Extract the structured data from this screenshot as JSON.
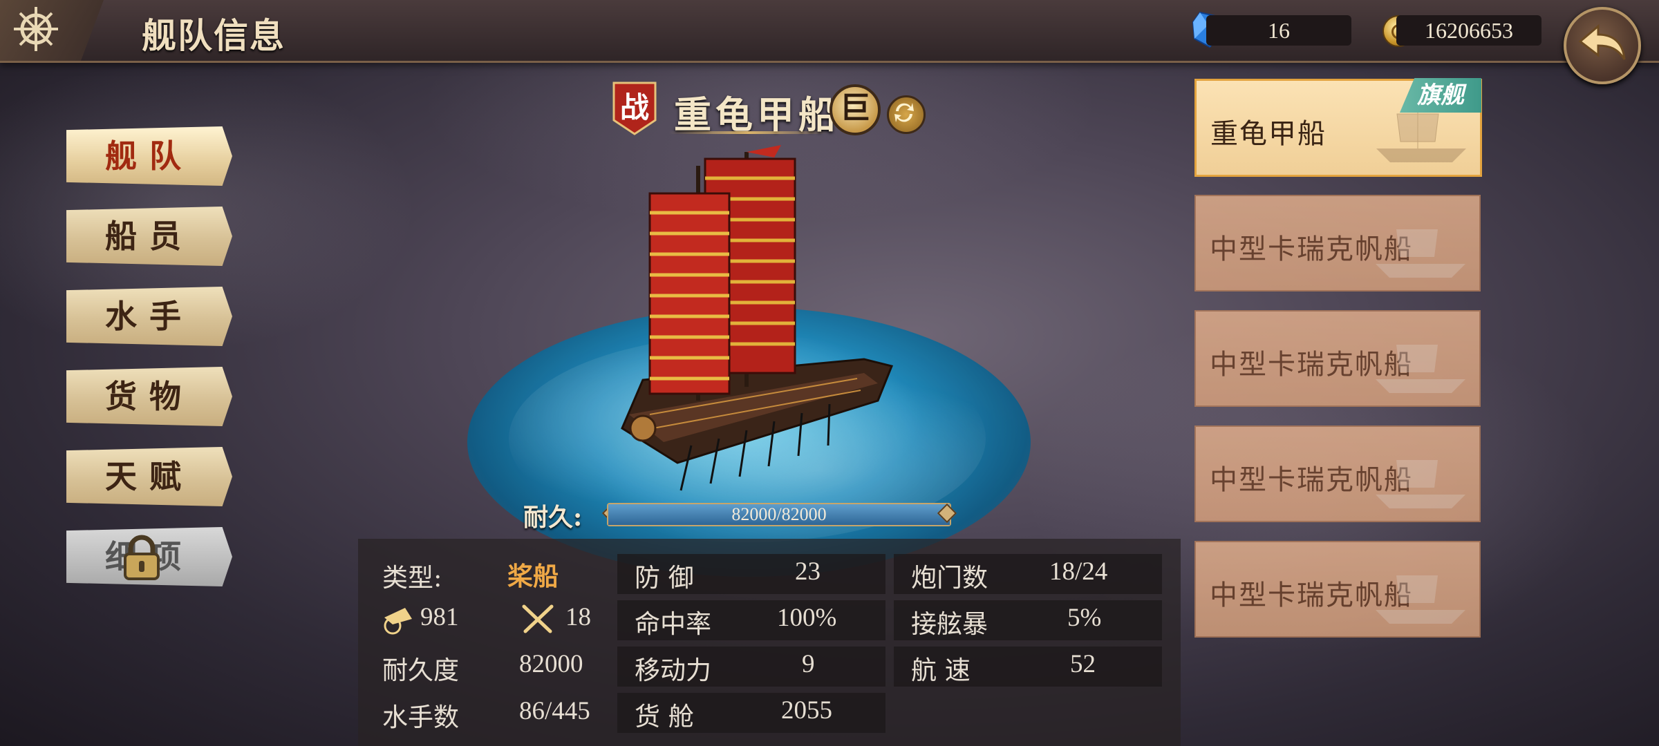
{
  "header": {
    "title": "舰队信息"
  },
  "resources": {
    "gems": "16",
    "coins": "16206653"
  },
  "menu": [
    {
      "label": "舰队",
      "active": true
    },
    {
      "label": "船员",
      "active": false
    },
    {
      "label": "水手",
      "active": false
    },
    {
      "label": "货物",
      "active": false
    },
    {
      "label": "天赋",
      "active": false
    },
    {
      "label": "细项",
      "active": false,
      "locked": true
    }
  ],
  "ship": {
    "badge": "战",
    "name": "重龟甲船",
    "size": "巨",
    "durability_label": "耐久:",
    "durability_text": "82000/82000",
    "durability_ratio": 1.0
  },
  "stats": {
    "type_label": "类型:",
    "type_value": "桨船",
    "cannon_value": "981",
    "melee_value": "18",
    "durability_label": "耐久度",
    "durability_value": "82000",
    "sailors_label": "水手数",
    "sailors_value": "86/445",
    "defense_label": "防 御",
    "defense_value": "23",
    "hit_label": "命中率",
    "hit_value": "100%",
    "move_label": "移动力",
    "move_value": "9",
    "cargo_label": "货 舱",
    "cargo_value": "2055",
    "gunports_label": "炮门数",
    "gunports_value": "18/24",
    "boarding_label": "接舷暴",
    "boarding_value": "5%",
    "speed_label": "航 速",
    "speed_value": "52"
  },
  "fleet": {
    "flagship_tag": "旗舰",
    "ships": [
      {
        "name": "重龟甲船",
        "selected": true
      },
      {
        "name": "中型卡瑞克帆船",
        "selected": false
      },
      {
        "name": "中型卡瑞克帆船",
        "selected": false
      },
      {
        "name": "中型卡瑞克帆船",
        "selected": false
      },
      {
        "name": "中型卡瑞克帆船",
        "selected": false
      }
    ]
  },
  "colors": {
    "accent": "#f0a946",
    "active_menu": "#a12a10",
    "flag_tag": "#4aa896"
  }
}
